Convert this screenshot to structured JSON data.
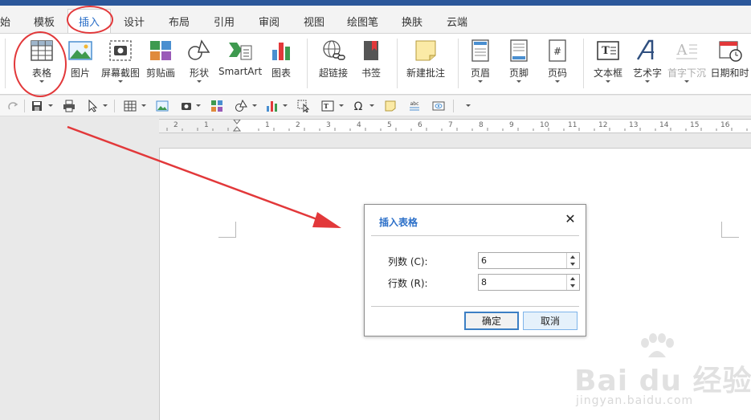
{
  "tabs": [
    {
      "label": "始"
    },
    {
      "label": "模板"
    },
    {
      "label": "插入"
    },
    {
      "label": "设计"
    },
    {
      "label": "布局"
    },
    {
      "label": "引用"
    },
    {
      "label": "审阅"
    },
    {
      "label": "视图"
    },
    {
      "label": "绘图笔"
    },
    {
      "label": "换肤"
    },
    {
      "label": "云端"
    }
  ],
  "active_tab": "插入",
  "ribbon": {
    "buttons": [
      {
        "label": "表格",
        "icon": "table-icon"
      },
      {
        "label": "图片",
        "icon": "picture-icon"
      },
      {
        "label": "屏幕截图",
        "icon": "screenshot-icon"
      },
      {
        "label": "剪贴画",
        "icon": "clipart-icon"
      },
      {
        "label": "形状",
        "icon": "shapes-icon"
      },
      {
        "label": "SmartArt",
        "icon": "smartart-icon"
      },
      {
        "label": "图表",
        "icon": "chart-icon"
      },
      {
        "label": "超链接",
        "icon": "hyperlink-icon"
      },
      {
        "label": "书签",
        "icon": "bookmark-icon"
      },
      {
        "label": "新建批注",
        "icon": "comment-icon"
      },
      {
        "label": "页眉",
        "icon": "header-icon"
      },
      {
        "label": "页脚",
        "icon": "footer-icon"
      },
      {
        "label": "页码",
        "icon": "page-number-icon"
      },
      {
        "label": "文本框",
        "icon": "textbox-icon"
      },
      {
        "label": "艺术字",
        "icon": "wordart-icon"
      },
      {
        "label": "首字下沉",
        "icon": "dropcap-icon"
      },
      {
        "label": "日期和时",
        "icon": "date-time-icon"
      }
    ]
  },
  "ruler": {
    "numbers": [
      "2",
      "1",
      "",
      "1",
      "2",
      "3",
      "4",
      "5",
      "6",
      "7",
      "8",
      "9",
      "10",
      "11",
      "12",
      "13",
      "14",
      "15",
      "16"
    ]
  },
  "dialog": {
    "title": "插入表格",
    "columns_label": "列数 (C):",
    "columns_value": "6",
    "rows_label": "行数 (R):",
    "rows_value": "8",
    "ok_label": "确定",
    "cancel_label": "取消"
  },
  "watermark": {
    "brand": "Bai du 经验",
    "url": "jingyan.baidu.com"
  },
  "colors": {
    "accent": "#2b6fc8",
    "title_bar": "#2b579a",
    "annotation": "#e2383a"
  }
}
